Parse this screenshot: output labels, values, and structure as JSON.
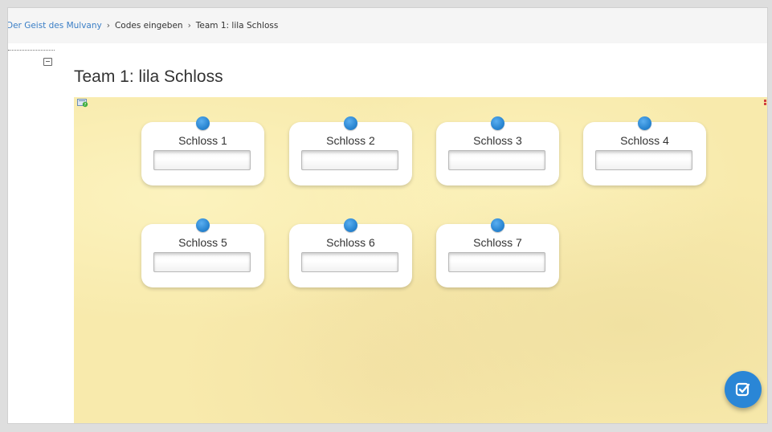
{
  "breadcrumb": {
    "items": [
      {
        "label": "Der Geist des Mulvany",
        "link": true
      },
      {
        "label": "Codes eingeben",
        "link": false
      },
      {
        "label": "Team 1: lila Schloss",
        "link": false
      }
    ],
    "separator": "›"
  },
  "page": {
    "title": "Team 1: lila Schloss"
  },
  "board": {
    "cards": [
      {
        "label": "Schloss 1",
        "value": ""
      },
      {
        "label": "Schloss 2",
        "value": ""
      },
      {
        "label": "Schloss 3",
        "value": ""
      },
      {
        "label": "Schloss 4",
        "value": ""
      },
      {
        "label": "Schloss 5",
        "value": ""
      },
      {
        "label": "Schloss 6",
        "value": ""
      },
      {
        "label": "Schloss 7",
        "value": ""
      }
    ]
  },
  "icons": {
    "help": "help-icon",
    "check": "check-icon",
    "collapse": "collapse-icon"
  },
  "colors": {
    "accent": "#2a86d6",
    "board_background": "#f8eaac",
    "link": "#3a7ec6"
  }
}
